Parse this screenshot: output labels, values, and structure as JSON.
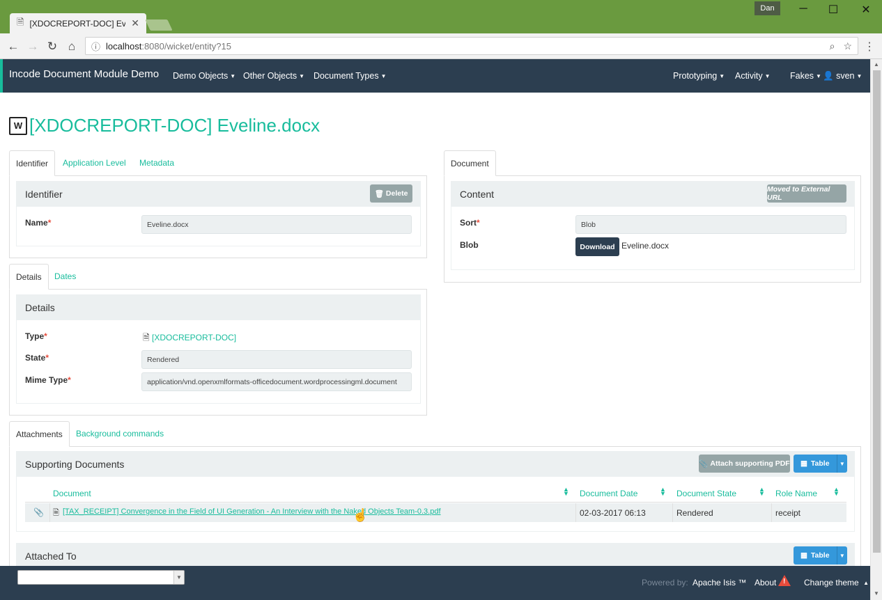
{
  "browser": {
    "tab_title": "[XDOCREPORT-DOC] Eve",
    "user_badge": "Dan",
    "url_host": "localhost",
    "url_path": ":8080/wicket/entity?15",
    "window_controls": {
      "minimize": "─",
      "maximize": "☐",
      "close": "✕"
    }
  },
  "appnav": {
    "brand": "Incode Document Module Demo",
    "left_menus": [
      "Demo Objects",
      "Other Objects",
      "Document Types"
    ],
    "right_menus": [
      "Prototyping",
      "Activity",
      "Fakes"
    ],
    "user": "sven"
  },
  "page": {
    "title": "[XDOCREPORT-DOC] Eveline.docx"
  },
  "identifier_tabs": {
    "tabs": [
      "Identifier",
      "Application Level",
      "Metadata"
    ]
  },
  "identifier_panel": {
    "heading": "Identifier",
    "delete_label": "Delete",
    "name_label": "Name",
    "name_value": "Eveline.docx"
  },
  "details_tabs": {
    "tabs": [
      "Details",
      "Dates"
    ]
  },
  "details_panel": {
    "heading": "Details",
    "type_label": "Type",
    "type_value": "[XDOCREPORT-DOC]",
    "state_label": "State",
    "state_value": "Rendered",
    "mime_label": "Mime Type",
    "mime_value": "application/vnd.openxmlformats-officedocument.wordprocessingml.document"
  },
  "document_tabs": {
    "tabs": [
      "Document"
    ]
  },
  "content_panel": {
    "heading": "Content",
    "moved_label": "Moved to External URL",
    "sort_label": "Sort",
    "sort_value": "Blob",
    "blob_label": "Blob",
    "download_label": "Download",
    "blob_filename": "Eveline.docx"
  },
  "attachments_tabs": {
    "tabs": [
      "Attachments",
      "Background commands"
    ]
  },
  "supporting_docs": {
    "heading": "Supporting Documents",
    "attach_label": "Attach supporting PDF",
    "table_label": "Table",
    "columns": [
      "Document",
      "Document Date",
      "Document State",
      "Role Name"
    ],
    "rows": [
      {
        "document": "[TAX_RECEIPT] Convergence in the Field of UI Generation - An Interview with the Naked Objects Team-0.3.pdf",
        "date": "02-03-2017 06:13",
        "state": "Rendered",
        "role": "receipt"
      }
    ]
  },
  "attached_to": {
    "heading": "Attached To",
    "table_label": "Table"
  },
  "footer": {
    "powered_by": "Powered by:",
    "isis": "Apache Isis ™",
    "about": "About",
    "change_theme": "Change theme"
  },
  "colors": {
    "accent": "#18bc9c",
    "navbar": "#2c3e50",
    "panel_head": "#ecf0f1",
    "primary_button": "#3498db",
    "grey_button": "#95a5a6",
    "danger": "#e74c3c",
    "browser_frame": "#6a9a3f"
  }
}
